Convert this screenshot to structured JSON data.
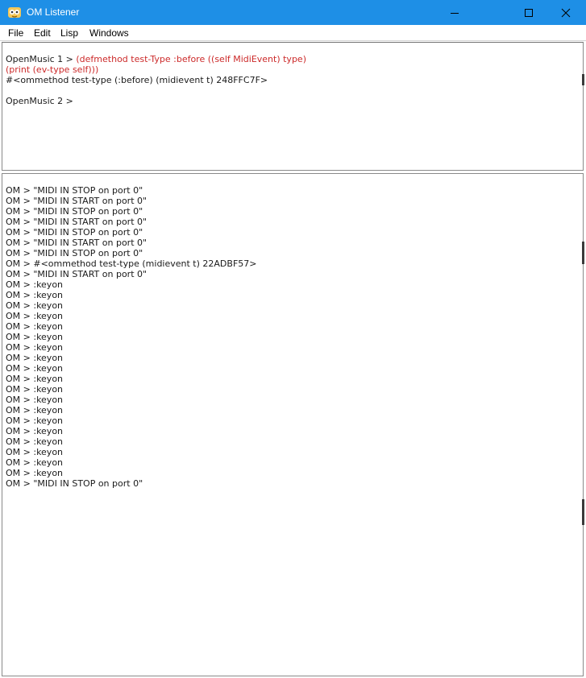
{
  "window": {
    "title": "OM Listener",
    "colors": {
      "titlebar": "#1e8fe6",
      "code_red": "#cc2a2a"
    },
    "controls": {
      "minimize_icon": "minimize-icon",
      "maximize_icon": "maximize-icon",
      "close_icon": "close-icon"
    }
  },
  "menu": {
    "file": "File",
    "edit": "Edit",
    "lisp": "Lisp",
    "windows": "Windows"
  },
  "input_pane": {
    "prompt1": "OpenMusic 1 > ",
    "code1": "(defmethod test-Type :before ((self MidiEvent) type)",
    "code2": "(print (ev-type self)))",
    "result1": "#<ommethod test-type (:before) (midievent t) 248FFC7F>",
    "prompt2": "OpenMusic 2 >"
  },
  "output_pane": {
    "lines": [
      "OM > \"MIDI IN STOP on port 0\"",
      "OM > \"MIDI IN START on port 0\"",
      "OM > \"MIDI IN STOP on port 0\"",
      "OM > \"MIDI IN START on port 0\"",
      "OM > \"MIDI IN STOP on port 0\"",
      "OM > \"MIDI IN START on port 0\"",
      "OM > \"MIDI IN STOP on port 0\"",
      "OM > #<ommethod test-type (midievent t) 22ADBF57>",
      "OM > \"MIDI IN START on port 0\"",
      "OM > :keyon",
      "OM > :keyon",
      "OM > :keyon",
      "OM > :keyon",
      "OM > :keyon",
      "OM > :keyon",
      "OM > :keyon",
      "OM > :keyon",
      "OM > :keyon",
      "OM > :keyon",
      "OM > :keyon",
      "OM > :keyon",
      "OM > :keyon",
      "OM > :keyon",
      "OM > :keyon",
      "OM > :keyon",
      "OM > :keyon",
      "OM > :keyon",
      "OM > :keyon",
      "OM > \"MIDI IN STOP on port 0\""
    ]
  }
}
